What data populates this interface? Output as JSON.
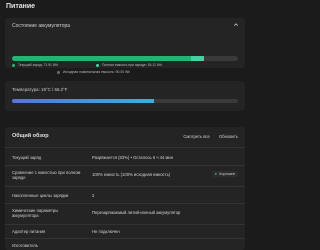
{
  "page": {
    "title": "Питание"
  },
  "battery_card": {
    "title": "Состояние аккумулятора",
    "bar": {
      "fill_fraction": 0.79,
      "second_segment_fraction": 0.06
    },
    "legend": [
      {
        "label": "Текущий заряд: 71.91 Wh",
        "color": "#1fb673"
      },
      {
        "label": "Полная емкость при заряде: 54.11 Wh",
        "color": "#46d1a0"
      },
      {
        "label": "Исходная номинальная емкость: 90.00 Wh",
        "color": "#6a6a6a"
      }
    ]
  },
  "temperature_card": {
    "label": "Температура: 19°C / 66.2°F",
    "fill_fraction": 0.63
  },
  "overview_card": {
    "title": "Общий обзор",
    "actions": [
      "Смотреть все",
      "Обновить"
    ],
    "rows": [
      {
        "key": "Текущий заряд",
        "value": "Разряжается (83%) • Осталось 5 ч 44 мин",
        "pill": ""
      },
      {
        "key": "Сравнение с емкостью при полном заряде",
        "value": "100% емкость (100% исходная емкость)",
        "pill": "Хорошее"
      },
      {
        "key": "Накопленные циклы зарядки",
        "value": "2",
        "pill": ""
      },
      {
        "key": "Химические параметры аккумулятора",
        "value": "Перезаряжаемый литий-ионный аккумулятор",
        "pill": ""
      },
      {
        "key": "Адаптер питания",
        "value": "Не подключен",
        "pill": ""
      },
      {
        "key": "Изготовитель",
        "value": "",
        "pill": ""
      }
    ]
  }
}
